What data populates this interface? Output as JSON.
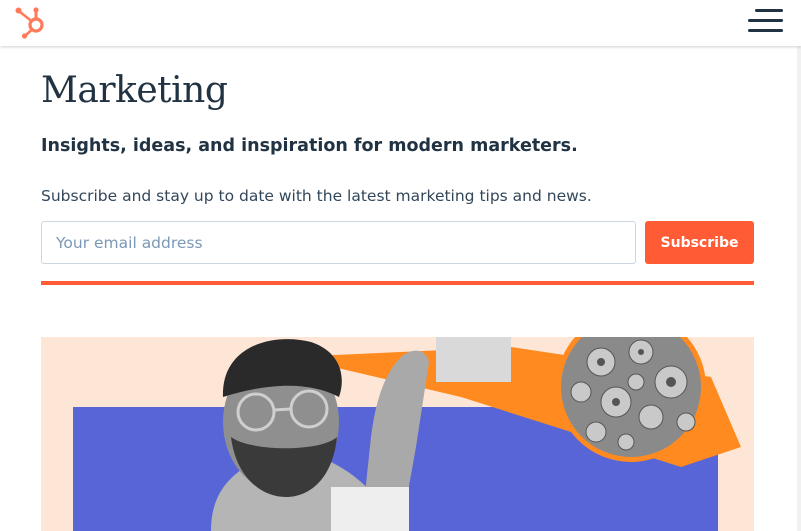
{
  "header": {
    "logo_icon": "hubspot-sprocket-icon",
    "menu_icon": "hamburger-menu-icon"
  },
  "page": {
    "title": "Marketing",
    "tagline": "Insights, ideas, and inspiration for modern marketers.",
    "subscribe_text": "Subscribe and stay up to date with the latest marketing tips and news."
  },
  "form": {
    "email_placeholder": "Your email address",
    "email_value": "",
    "subscribe_label": "Subscribe"
  },
  "colors": {
    "accent": "#ff5c35",
    "heading": "#213343",
    "hero_bg": "#fde6d6",
    "hero_blue": "#5865d6",
    "hero_orange": "#ff8a1f"
  }
}
